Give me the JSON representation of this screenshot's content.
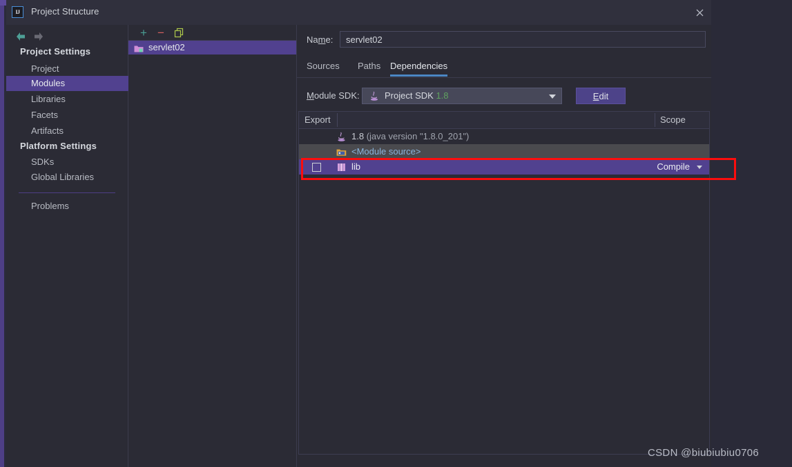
{
  "window": {
    "title": "Project Structure",
    "logo_text": "IJ",
    "close_icon": "close-icon"
  },
  "nav": {
    "back_icon": "arrow-left-icon",
    "forward_icon": "arrow-right-icon"
  },
  "sidebar": {
    "groups": [
      {
        "label": "Project Settings"
      },
      {
        "label": "Platform Settings"
      }
    ],
    "items": [
      {
        "label": "Project",
        "selected": false
      },
      {
        "label": "Modules",
        "selected": true
      },
      {
        "label": "Libraries",
        "selected": false
      },
      {
        "label": "Facets",
        "selected": false
      },
      {
        "label": "Artifacts",
        "selected": false
      },
      {
        "label": "SDKs",
        "selected": false
      },
      {
        "label": "Global Libraries",
        "selected": false
      },
      {
        "label": "Problems",
        "selected": false
      }
    ]
  },
  "modules_panel": {
    "toolbar": {
      "add_label": "+",
      "remove_label": "−",
      "copy_icon": "copy-icon"
    },
    "modules": [
      {
        "name": "servlet02",
        "icon": "module-folder-icon",
        "selected": true
      }
    ]
  },
  "content": {
    "name_field": {
      "label_pre": "Na",
      "label_key": "m",
      "label_post": "e:",
      "value": "servlet02"
    },
    "tabs": [
      {
        "label": "Sources",
        "active": false
      },
      {
        "label": "Paths",
        "active": false
      },
      {
        "label": "Dependencies",
        "active": true
      }
    ],
    "sdk_row": {
      "label_key": "M",
      "label_rest": "odule SDK:",
      "combo_icon": "java-icon",
      "combo_text": "Project SDK",
      "combo_version": "1.8",
      "dropdown_icon": "chevron-down-icon",
      "edit_button_key": "E",
      "edit_button_rest": "dit"
    },
    "table": {
      "headers": {
        "export": "Export",
        "scope": "Scope"
      },
      "rows": [
        {
          "icon": "java-icon",
          "text": "1.8",
          "detail": " (java version \"1.8.0_201\")",
          "scope": "",
          "checkbox": false,
          "state": "normal"
        },
        {
          "icon": "module-source-folder-icon",
          "text": "<Module source>",
          "detail": "",
          "scope": "",
          "checkbox": false,
          "state": "alt"
        },
        {
          "icon": "library-icon",
          "text": "lib",
          "detail": "",
          "scope": "Compile",
          "scope_icon": "chevron-down-icon",
          "checkbox": true,
          "state": "selected"
        }
      ]
    }
  },
  "annotation": {
    "highlight_color": "#fb0d0d"
  },
  "watermark": {
    "text": "CSDN @biubiubiu0706"
  },
  "colors": {
    "dialog_bg": "#2b2b35",
    "titlebar_bg": "#30303d",
    "selection_purple": "#51418f",
    "tab_underline_blue": "#4b87c5",
    "sdk_version_green": "#5fa25f",
    "link_blue": "#8ab4dd",
    "alt_row_gray": "#4a4a4e"
  }
}
